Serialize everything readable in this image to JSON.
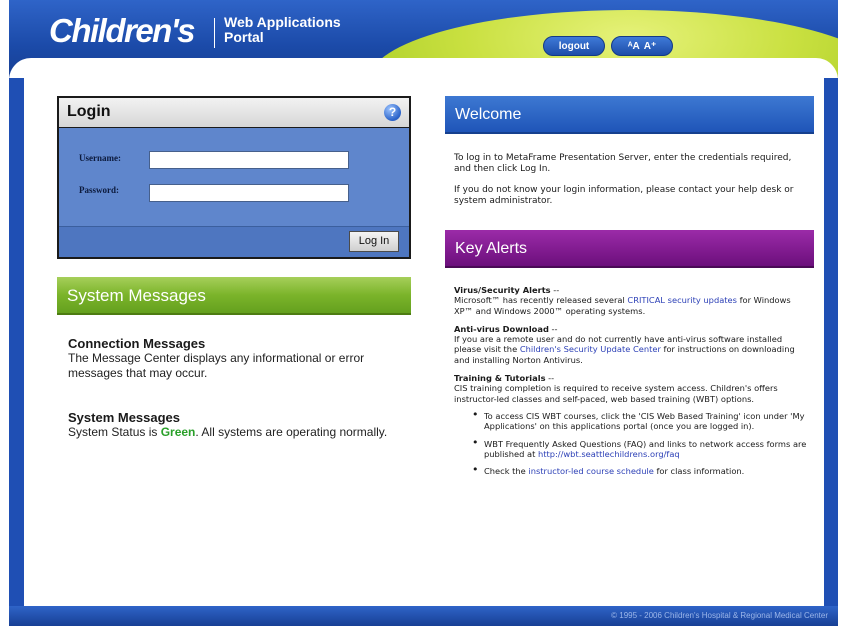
{
  "header": {
    "brand": "Children's",
    "portal_title_line1": "Web Applications",
    "portal_title_line2": "Portal",
    "logout_label": "logout",
    "font_decrease": "ᴬA",
    "font_increase": "A⁺"
  },
  "login": {
    "title": "Login",
    "help_icon": "help-icon",
    "username_label": "Username:",
    "password_label": "Password:",
    "username_value": "",
    "password_value": "",
    "login_button": "Log In"
  },
  "system_messages": {
    "header": "System Messages",
    "connection_title": "Connection Messages",
    "connection_text": "The Message Center displays any informational or error messages that may occur.",
    "system_title": "System Messages",
    "status_prefix": "System Status is ",
    "status_value": "Green",
    "status_suffix": ". All systems are operating normally."
  },
  "welcome": {
    "header": "Welcome",
    "paragraph1": "To log in to MetaFrame Presentation Server, enter the credentials required, and then click Log In.",
    "paragraph2": "If you do not know your login information, please contact your help desk or system administrator."
  },
  "key_alerts": {
    "header": "Key Alerts",
    "alert1_title": "Virus/Security Alerts",
    "alert1_dash": " --",
    "alert1_text_a": "Microsoft™ has recently released several ",
    "alert1_link": "CRITICAL security updates",
    "alert1_text_b": " for Windows XP™ and Windows 2000™ operating systems.",
    "alert2_title": "Anti-virus Download",
    "alert2_dash": " --",
    "alert2_text_a": "If you are a remote user and do not currently have anti-virus software installed please visit the ",
    "alert2_link": "Children's Security Update Center",
    "alert2_text_b": " for instructions on downloading and installing Norton Antivirus.",
    "alert3_title": "Training & Tutorials",
    "alert3_dash": " --",
    "alert3_text": "CIS training completion is required to receive system access. Children's offers instructor-led classes and self-paced, web based training (WBT) options.",
    "bullet1": "To access CIS WBT courses, click the 'CIS Web Based Training' icon under 'My Applications' on this applications portal (once you are logged in).",
    "bullet2_a": "WBT Frequently Asked Questions (FAQ) and links to network access forms are published at ",
    "bullet2_link": "http://wbt.seattlechildrens.org/faq",
    "bullet3_a": "Check the ",
    "bullet3_link": "instructor-led course schedule",
    "bullet3_b": " for class information."
  },
  "footer": {
    "copyright": "© 1995 - 2006 Children's Hospital & Regional Medical Center"
  },
  "colors": {
    "header_blue": "#1f4fb4",
    "green_swoosh": "#c9e040",
    "login_panel": "#5f86cc",
    "system_green": "#7bb42a",
    "welcome_blue": "#2a62c8",
    "alerts_purple": "#7d1690",
    "status_green": "#2aa02a",
    "link_blue": "#2b3fb6"
  }
}
